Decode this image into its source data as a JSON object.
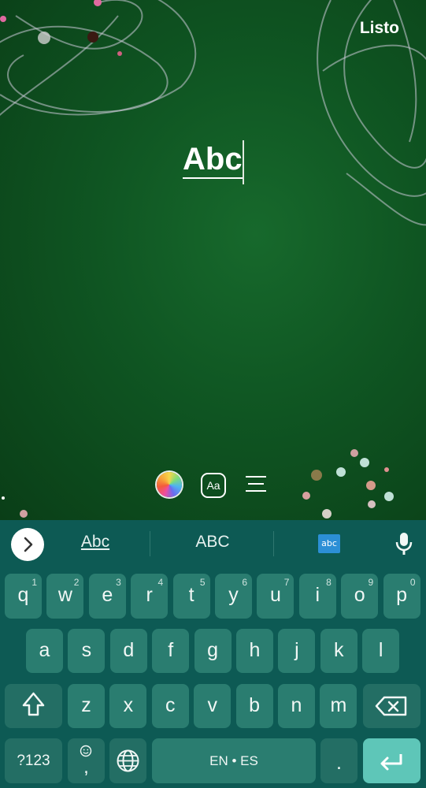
{
  "header": {
    "done_label": "Listo"
  },
  "editor": {
    "text": "Abc"
  },
  "toolbar": {
    "font_label": "Aa"
  },
  "suggestions": {
    "items": [
      "Abc",
      "ABC"
    ],
    "sticker_label": "abc"
  },
  "keyboard": {
    "row1": [
      {
        "k": "q",
        "h": "1"
      },
      {
        "k": "w",
        "h": "2"
      },
      {
        "k": "e",
        "h": "3"
      },
      {
        "k": "r",
        "h": "4"
      },
      {
        "k": "t",
        "h": "5"
      },
      {
        "k": "y",
        "h": "6"
      },
      {
        "k": "u",
        "h": "7"
      },
      {
        "k": "i",
        "h": "8"
      },
      {
        "k": "o",
        "h": "9"
      },
      {
        "k": "p",
        "h": "0"
      }
    ],
    "row2": [
      "a",
      "s",
      "d",
      "f",
      "g",
      "h",
      "j",
      "k",
      "l"
    ],
    "row3": [
      "z",
      "x",
      "c",
      "v",
      "b",
      "n",
      "m"
    ],
    "symbols_label": "?123",
    "comma_label": ",",
    "space_label": "EN • ES",
    "period_label": "."
  },
  "colors": {
    "background": "#0f5522",
    "keyboard": "#0d5a54",
    "key": "#2a7d70",
    "enter": "#5ec6b8"
  }
}
